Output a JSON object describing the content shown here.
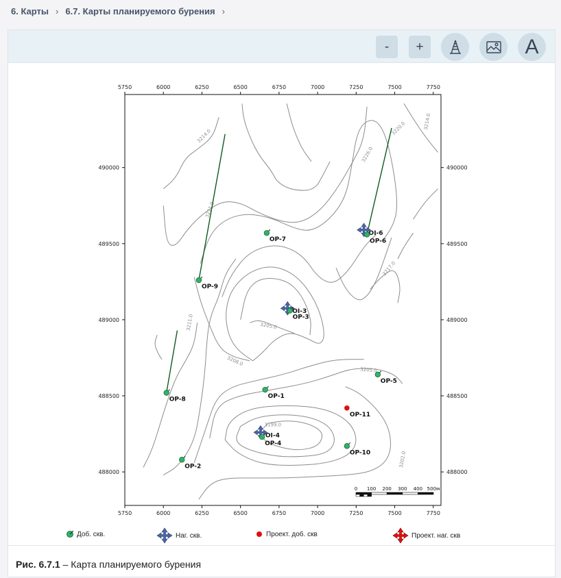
{
  "breadcrumb": {
    "item1": "6. Карты",
    "item2": "6.7. Карты планируемого бурения",
    "sep": "›"
  },
  "toolbar": {
    "zoom_out": "-",
    "zoom_in": "+",
    "tool3_icon": "oil-rig-icon",
    "tool4_icon": "map-image-icon",
    "tool5_label": "A"
  },
  "map": {
    "x_ticks": [
      "5750",
      "6000",
      "6250",
      "6500",
      "6750",
      "7000",
      "7250",
      "7500",
      "7750"
    ],
    "y_ticks": [
      "490000",
      "489500",
      "489000",
      "488500",
      "488000"
    ],
    "x_tick_values": [
      5750,
      6000,
      6250,
      6500,
      6750,
      7000,
      7250,
      7500,
      7750
    ],
    "y_tick_values": [
      490000,
      489500,
      489000,
      488500,
      488000
    ],
    "x_range": [
      5750,
      7800
    ],
    "y_range": [
      487780,
      490480
    ],
    "contour_labels": [
      {
        "text": "3214.0",
        "x": 6270,
        "y": 490200,
        "rot": -45
      },
      {
        "text": "3211.0",
        "x": 6310,
        "y": 489720,
        "rot": -70
      },
      {
        "text": "3211.0",
        "x": 6180,
        "y": 488980,
        "rot": -80
      },
      {
        "text": "3208.0",
        "x": 6460,
        "y": 488720,
        "rot": 25
      },
      {
        "text": "3205.0",
        "x": 6680,
        "y": 488950,
        "rot": 10
      },
      {
        "text": "3199.0",
        "x": 6710,
        "y": 488300,
        "rot": 0
      },
      {
        "text": "3205.0",
        "x": 7330,
        "y": 488660,
        "rot": 5
      },
      {
        "text": "3202.0",
        "x": 7560,
        "y": 488080,
        "rot": -80
      },
      {
        "text": "3217.0",
        "x": 7470,
        "y": 489330,
        "rot": -50
      },
      {
        "text": "3220.0",
        "x": 7530,
        "y": 490250,
        "rot": -45
      },
      {
        "text": "3226.0",
        "x": 7330,
        "y": 490080,
        "rot": -60
      },
      {
        "text": "3214.0",
        "x": 7720,
        "y": 490300,
        "rot": -80
      }
    ],
    "wells": [
      {
        "name": "OP-7",
        "type": "prod",
        "x": 6670,
        "y": 489570
      },
      {
        "name": "OP-9",
        "type": "prod",
        "x": 6230,
        "y": 489260
      },
      {
        "name": "OP-8",
        "type": "prod",
        "x": 6020,
        "y": 488520
      },
      {
        "name": "OP-1",
        "type": "prod",
        "x": 6660,
        "y": 488540
      },
      {
        "name": "OP-2",
        "type": "prod",
        "x": 6120,
        "y": 488080
      },
      {
        "name": "OP-5",
        "type": "prod",
        "x": 7390,
        "y": 488640
      },
      {
        "name": "OP-10",
        "type": "prod",
        "x": 7190,
        "y": 488170
      },
      {
        "name": "OP-11",
        "type": "proj-prod",
        "x": 7190,
        "y": 488420
      },
      {
        "name": "OP-3",
        "type": "prod",
        "x": 6820,
        "y": 489060
      },
      {
        "name": "OP-4",
        "type": "prod",
        "x": 6640,
        "y": 488230
      },
      {
        "name": "OP-6",
        "type": "prod",
        "x": 7320,
        "y": 489560
      }
    ],
    "injectors": [
      {
        "name": "OI-3",
        "x": 6805,
        "y": 489075
      },
      {
        "name": "OI-4",
        "x": 6630,
        "y": 488260
      },
      {
        "name": "OI-6",
        "x": 7300,
        "y": 489590
      }
    ],
    "scalebar": {
      "labels": [
        "0",
        "100",
        "200",
        "300",
        "400",
        "500м"
      ]
    }
  },
  "legend": {
    "prod": "Доб. скв.",
    "inj": "Наг. скв.",
    "proj_prod": "Проект. доб. скв",
    "proj_inj": "Проект. наг. скв"
  },
  "caption": {
    "bold": "Рис. 6.7.1",
    "text": " – Карта планируемого бурения"
  },
  "colors": {
    "prod": "#2fb36a",
    "inj": "#4a67a8",
    "proj": "#e01010",
    "contour": "#8c8c8c",
    "trajectory": "#0f5a1e"
  }
}
